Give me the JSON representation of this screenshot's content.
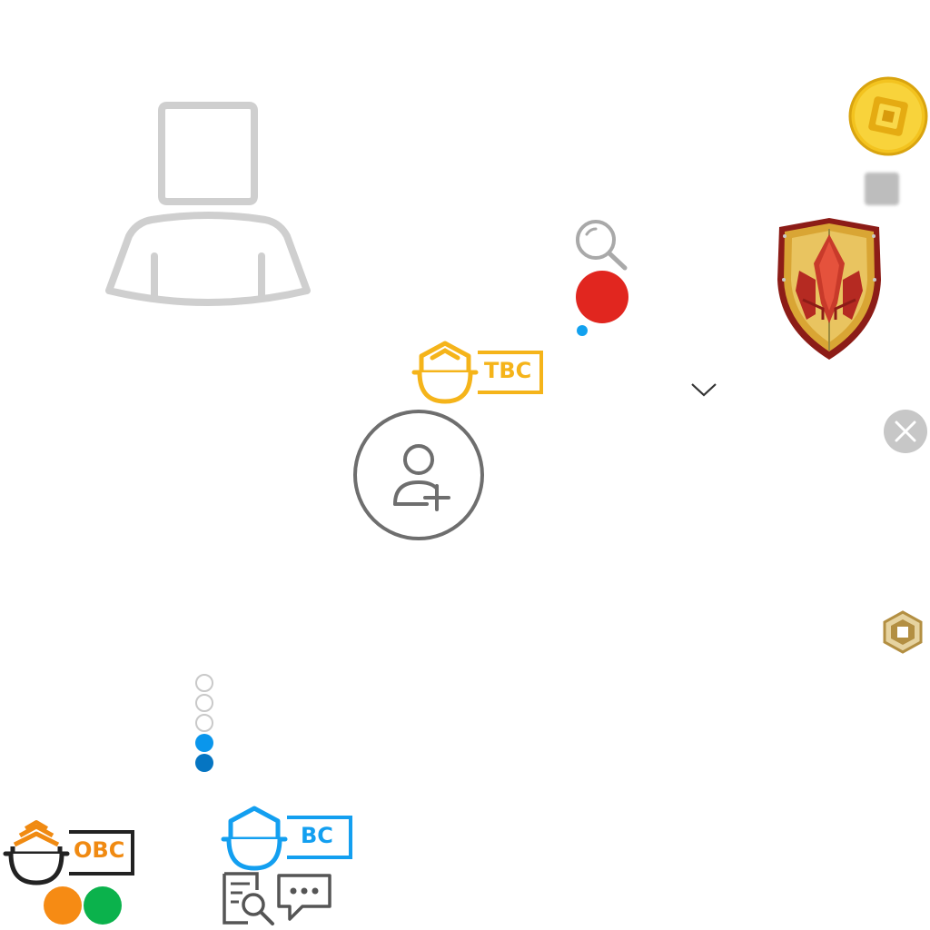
{
  "badges": {
    "tbc": {
      "label": "TBC",
      "color": "#f5b41a"
    },
    "obc": {
      "label": "OBC",
      "color": "#f08a12",
      "frame": "#222222"
    },
    "bc": {
      "label": "BC",
      "color": "#139ff0"
    }
  },
  "icons": {
    "avatar_placeholder": "avatar-placeholder-icon",
    "robux_coin": "robux-coin-icon",
    "search": "search-icon",
    "shield": "shield-icon",
    "chevron": "chevron-down-icon",
    "close": "close-icon",
    "add_friend": "add-friend-icon",
    "robux_small": "robux-small-icon",
    "catalog_search": "catalog-search-icon",
    "chat": "chat-icon"
  },
  "colors": {
    "notification_red": "#e1261f",
    "online_blue": "#12a1ef",
    "orange_status": "#f68b14",
    "green_status": "#0bb24c",
    "page_dot_active": "#0a96ec",
    "page_dot_dark": "#0575c2",
    "placeholder_grey": "#cfcfcf"
  },
  "pagination": {
    "total": 5,
    "states": [
      "inactive",
      "inactive",
      "inactive",
      "active",
      "active-dark"
    ]
  }
}
